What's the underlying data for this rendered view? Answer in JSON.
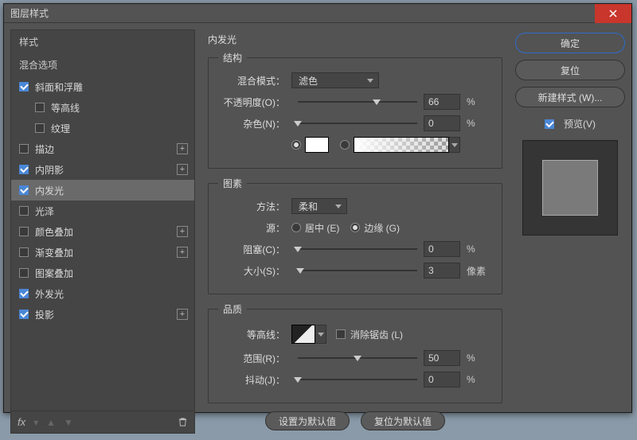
{
  "window": {
    "title": "图层样式"
  },
  "sidebar": {
    "styles_header": "样式",
    "blending_header": "混合选项",
    "items": [
      {
        "label": "斜面和浮雕",
        "checked": true,
        "plus": false,
        "indent": false
      },
      {
        "label": "等高线",
        "checked": false,
        "plus": false,
        "indent": true
      },
      {
        "label": "纹理",
        "checked": false,
        "plus": false,
        "indent": true
      },
      {
        "label": "描边",
        "checked": false,
        "plus": true,
        "indent": false
      },
      {
        "label": "内阴影",
        "checked": true,
        "plus": true,
        "indent": false
      },
      {
        "label": "内发光",
        "checked": true,
        "plus": false,
        "indent": false,
        "active": true
      },
      {
        "label": "光泽",
        "checked": false,
        "plus": false,
        "indent": false
      },
      {
        "label": "颜色叠加",
        "checked": false,
        "plus": true,
        "indent": false
      },
      {
        "label": "渐变叠加",
        "checked": false,
        "plus": true,
        "indent": false
      },
      {
        "label": "图案叠加",
        "checked": false,
        "plus": false,
        "indent": false
      },
      {
        "label": "外发光",
        "checked": true,
        "plus": false,
        "indent": false
      },
      {
        "label": "投影",
        "checked": true,
        "plus": true,
        "indent": false
      }
    ],
    "fx_label": "fx"
  },
  "panel": {
    "title": "内发光",
    "group_structure": "结构",
    "blend_mode_label": "混合模式：",
    "blend_mode_value": "滤色",
    "opacity_label": "不透明度(O)：",
    "opacity_value": "66",
    "noise_label": "杂色(N)：",
    "noise_value": "0",
    "percent": "%",
    "group_elements": "图素",
    "technique_label": "方法：",
    "technique_value": "柔和",
    "source_label": "源：",
    "source_center": "居中 (E)",
    "source_edge": "边缘 (G)",
    "choke_label": "阻塞(C)：",
    "choke_value": "0",
    "size_label": "大小(S)：",
    "size_value": "3",
    "px": "像素",
    "group_quality": "品质",
    "contour_label": "等高线：",
    "antialias_label": "消除锯齿 (L)",
    "range_label": "范围(R)：",
    "range_value": "50",
    "jitter_label": "抖动(J)：",
    "jitter_value": "0",
    "make_default": "设置为默认值",
    "reset_default": "复位为默认值"
  },
  "buttons": {
    "ok": "确定",
    "cancel": "复位",
    "new_style": "新建样式 (W)...",
    "preview": "预览(V)"
  }
}
